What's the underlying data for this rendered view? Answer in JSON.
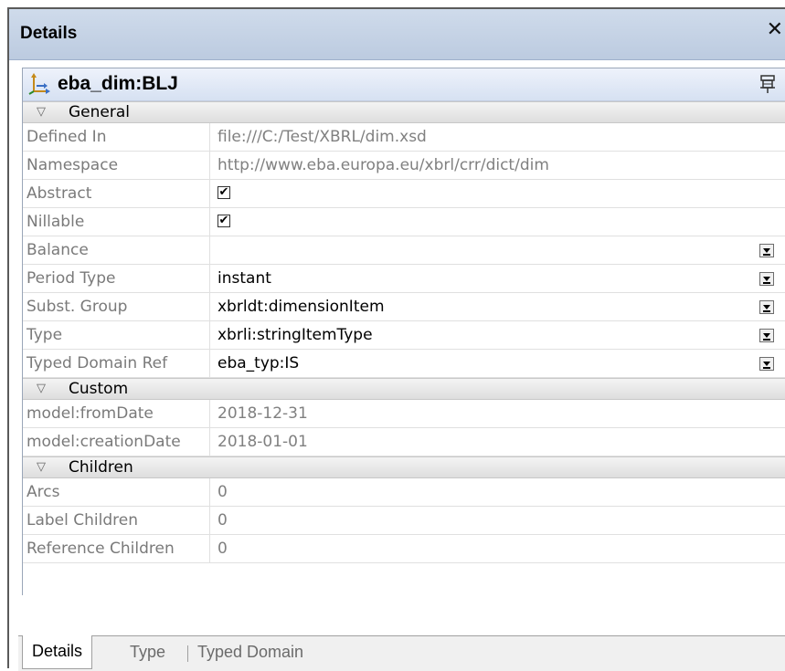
{
  "window": {
    "title": "Details",
    "close_glyph": "✕"
  },
  "element": {
    "name": "eba_dim:BLJ",
    "icon": "dimension-axis-icon",
    "pin_icon": "pin-icon"
  },
  "groups": [
    {
      "label": "General",
      "rows": [
        {
          "key": "Defined In",
          "value": "file:///C:/Test/XBRL/dim.xsd",
          "kind": "text",
          "editable": false
        },
        {
          "key": "Namespace",
          "value": "http://www.eba.europa.eu/xbrl/crr/dict/dim",
          "kind": "text",
          "editable": false
        },
        {
          "key": "Abstract",
          "value": "✔",
          "kind": "checkbox"
        },
        {
          "key": "Nillable",
          "value": "✔",
          "kind": "checkbox"
        },
        {
          "key": "Balance",
          "value": "",
          "kind": "dropdown"
        },
        {
          "key": "Period Type",
          "value": "instant",
          "kind": "dropdown"
        },
        {
          "key": "Subst. Group",
          "value": "xbrldt:dimensionItem",
          "kind": "dropdown"
        },
        {
          "key": "Type",
          "value": "xbrli:stringItemType",
          "kind": "dropdown"
        },
        {
          "key": "Typed Domain Ref",
          "value": "eba_typ:IS",
          "kind": "dropdown"
        }
      ]
    },
    {
      "label": "Custom",
      "rows": [
        {
          "key": "model:fromDate",
          "value": "2018-12-31",
          "kind": "text",
          "editable": false
        },
        {
          "key": "model:creationDate",
          "value": "2018-01-01",
          "kind": "text",
          "editable": false
        }
      ]
    },
    {
      "label": "Children",
      "rows": [
        {
          "key": "Arcs",
          "value": "0",
          "kind": "text",
          "editable": false
        },
        {
          "key": "Label Children",
          "value": "0",
          "kind": "text",
          "editable": false
        },
        {
          "key": "Reference Children",
          "value": "0",
          "kind": "text",
          "editable": false
        }
      ]
    }
  ],
  "collapse_glyph": "▽",
  "tabs": [
    {
      "label": "Details",
      "active": true
    },
    {
      "label": "Type",
      "active": false
    },
    {
      "label": "Typed Domain",
      "active": false
    }
  ],
  "colors": {
    "titlebar": "#c5d3e8",
    "heading": "#dfe7f5",
    "group_band": "#e6e6e6",
    "readonly_text": "#808080"
  }
}
